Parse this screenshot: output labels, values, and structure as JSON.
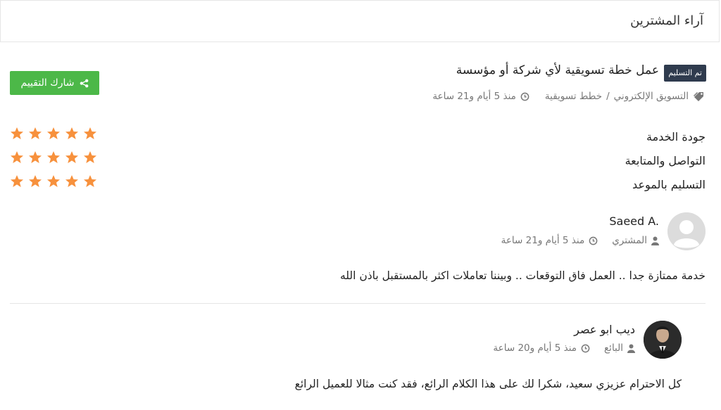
{
  "header": {
    "title": "آراء المشترين"
  },
  "service": {
    "status_badge": "تم التسليم",
    "title": "عمل خطة تسويقية لأي شركة أو مؤسسة",
    "category": "التسويق الإلكتروني",
    "separator": "/",
    "subcategory": "خطط تسويقية",
    "time": "منذ 5 أيام و21 ساعة"
  },
  "share_button": {
    "label": "شارك التقييم"
  },
  "ratings": [
    {
      "label": "جودة الخدمة",
      "stars": 5,
      "max": 5
    },
    {
      "label": "التواصل والمتابعة",
      "stars": 5,
      "max": 5
    },
    {
      "label": "التسليم بالموعد",
      "stars": 5,
      "max": 5
    }
  ],
  "review": {
    "name": "Saeed A.",
    "role": "المشتري",
    "time": "منذ 5 أيام و21 ساعة",
    "text": "خدمة ممتازة جدا .. العمل فاق التوقعات .. وبيننا تعاملات اكثر بالمستقبل باذن الله"
  },
  "reply": {
    "name": "ديب ابو عصر",
    "role": "البائع",
    "time": "منذ 5 أيام و20 ساعة",
    "text": "كل الاحترام عزيزي سعيد، شكرا لك على هذا الكلام الرائع، فقد كنت مثالا للعميل الرائع"
  },
  "colors": {
    "star": "#f7913d",
    "share": "#4cb848",
    "badge": "#2f3b4e",
    "meta": "#777777"
  },
  "icons": [
    "tags-icon",
    "clock-icon",
    "share-icon",
    "star-icon",
    "user-icon",
    "avatar-placeholder-icon"
  ]
}
